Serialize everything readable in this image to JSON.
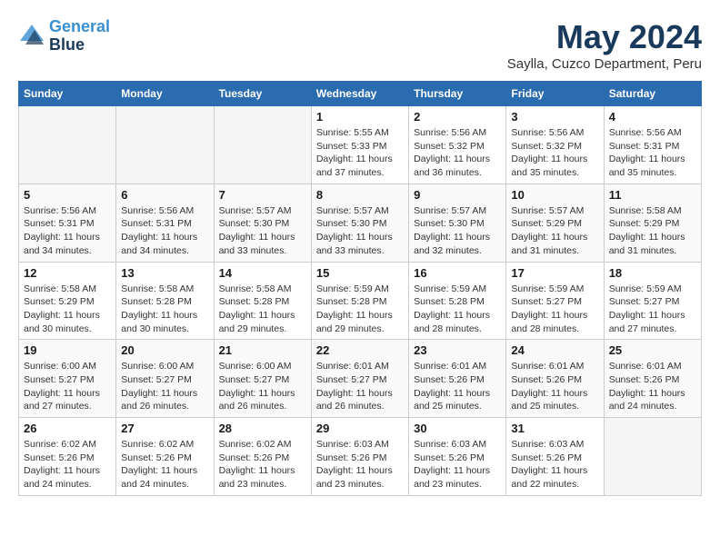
{
  "header": {
    "logo_line1": "General",
    "logo_line2": "Blue",
    "month": "May 2024",
    "location": "Saylla, Cuzco Department, Peru"
  },
  "days_of_week": [
    "Sunday",
    "Monday",
    "Tuesday",
    "Wednesday",
    "Thursday",
    "Friday",
    "Saturday"
  ],
  "weeks": [
    [
      {
        "day": "",
        "info": ""
      },
      {
        "day": "",
        "info": ""
      },
      {
        "day": "",
        "info": ""
      },
      {
        "day": "1",
        "info": "Sunrise: 5:55 AM\nSunset: 5:33 PM\nDaylight: 11 hours\nand 37 minutes."
      },
      {
        "day": "2",
        "info": "Sunrise: 5:56 AM\nSunset: 5:32 PM\nDaylight: 11 hours\nand 36 minutes."
      },
      {
        "day": "3",
        "info": "Sunrise: 5:56 AM\nSunset: 5:32 PM\nDaylight: 11 hours\nand 35 minutes."
      },
      {
        "day": "4",
        "info": "Sunrise: 5:56 AM\nSunset: 5:31 PM\nDaylight: 11 hours\nand 35 minutes."
      }
    ],
    [
      {
        "day": "5",
        "info": "Sunrise: 5:56 AM\nSunset: 5:31 PM\nDaylight: 11 hours\nand 34 minutes."
      },
      {
        "day": "6",
        "info": "Sunrise: 5:56 AM\nSunset: 5:31 PM\nDaylight: 11 hours\nand 34 minutes."
      },
      {
        "day": "7",
        "info": "Sunrise: 5:57 AM\nSunset: 5:30 PM\nDaylight: 11 hours\nand 33 minutes."
      },
      {
        "day": "8",
        "info": "Sunrise: 5:57 AM\nSunset: 5:30 PM\nDaylight: 11 hours\nand 33 minutes."
      },
      {
        "day": "9",
        "info": "Sunrise: 5:57 AM\nSunset: 5:30 PM\nDaylight: 11 hours\nand 32 minutes."
      },
      {
        "day": "10",
        "info": "Sunrise: 5:57 AM\nSunset: 5:29 PM\nDaylight: 11 hours\nand 31 minutes."
      },
      {
        "day": "11",
        "info": "Sunrise: 5:58 AM\nSunset: 5:29 PM\nDaylight: 11 hours\nand 31 minutes."
      }
    ],
    [
      {
        "day": "12",
        "info": "Sunrise: 5:58 AM\nSunset: 5:29 PM\nDaylight: 11 hours\nand 30 minutes."
      },
      {
        "day": "13",
        "info": "Sunrise: 5:58 AM\nSunset: 5:28 PM\nDaylight: 11 hours\nand 30 minutes."
      },
      {
        "day": "14",
        "info": "Sunrise: 5:58 AM\nSunset: 5:28 PM\nDaylight: 11 hours\nand 29 minutes."
      },
      {
        "day": "15",
        "info": "Sunrise: 5:59 AM\nSunset: 5:28 PM\nDaylight: 11 hours\nand 29 minutes."
      },
      {
        "day": "16",
        "info": "Sunrise: 5:59 AM\nSunset: 5:28 PM\nDaylight: 11 hours\nand 28 minutes."
      },
      {
        "day": "17",
        "info": "Sunrise: 5:59 AM\nSunset: 5:27 PM\nDaylight: 11 hours\nand 28 minutes."
      },
      {
        "day": "18",
        "info": "Sunrise: 5:59 AM\nSunset: 5:27 PM\nDaylight: 11 hours\nand 27 minutes."
      }
    ],
    [
      {
        "day": "19",
        "info": "Sunrise: 6:00 AM\nSunset: 5:27 PM\nDaylight: 11 hours\nand 27 minutes."
      },
      {
        "day": "20",
        "info": "Sunrise: 6:00 AM\nSunset: 5:27 PM\nDaylight: 11 hours\nand 26 minutes."
      },
      {
        "day": "21",
        "info": "Sunrise: 6:00 AM\nSunset: 5:27 PM\nDaylight: 11 hours\nand 26 minutes."
      },
      {
        "day": "22",
        "info": "Sunrise: 6:01 AM\nSunset: 5:27 PM\nDaylight: 11 hours\nand 26 minutes."
      },
      {
        "day": "23",
        "info": "Sunrise: 6:01 AM\nSunset: 5:26 PM\nDaylight: 11 hours\nand 25 minutes."
      },
      {
        "day": "24",
        "info": "Sunrise: 6:01 AM\nSunset: 5:26 PM\nDaylight: 11 hours\nand 25 minutes."
      },
      {
        "day": "25",
        "info": "Sunrise: 6:01 AM\nSunset: 5:26 PM\nDaylight: 11 hours\nand 24 minutes."
      }
    ],
    [
      {
        "day": "26",
        "info": "Sunrise: 6:02 AM\nSunset: 5:26 PM\nDaylight: 11 hours\nand 24 minutes."
      },
      {
        "day": "27",
        "info": "Sunrise: 6:02 AM\nSunset: 5:26 PM\nDaylight: 11 hours\nand 24 minutes."
      },
      {
        "day": "28",
        "info": "Sunrise: 6:02 AM\nSunset: 5:26 PM\nDaylight: 11 hours\nand 23 minutes."
      },
      {
        "day": "29",
        "info": "Sunrise: 6:03 AM\nSunset: 5:26 PM\nDaylight: 11 hours\nand 23 minutes."
      },
      {
        "day": "30",
        "info": "Sunrise: 6:03 AM\nSunset: 5:26 PM\nDaylight: 11 hours\nand 23 minutes."
      },
      {
        "day": "31",
        "info": "Sunrise: 6:03 AM\nSunset: 5:26 PM\nDaylight: 11 hours\nand 22 minutes."
      },
      {
        "day": "",
        "info": ""
      }
    ]
  ]
}
